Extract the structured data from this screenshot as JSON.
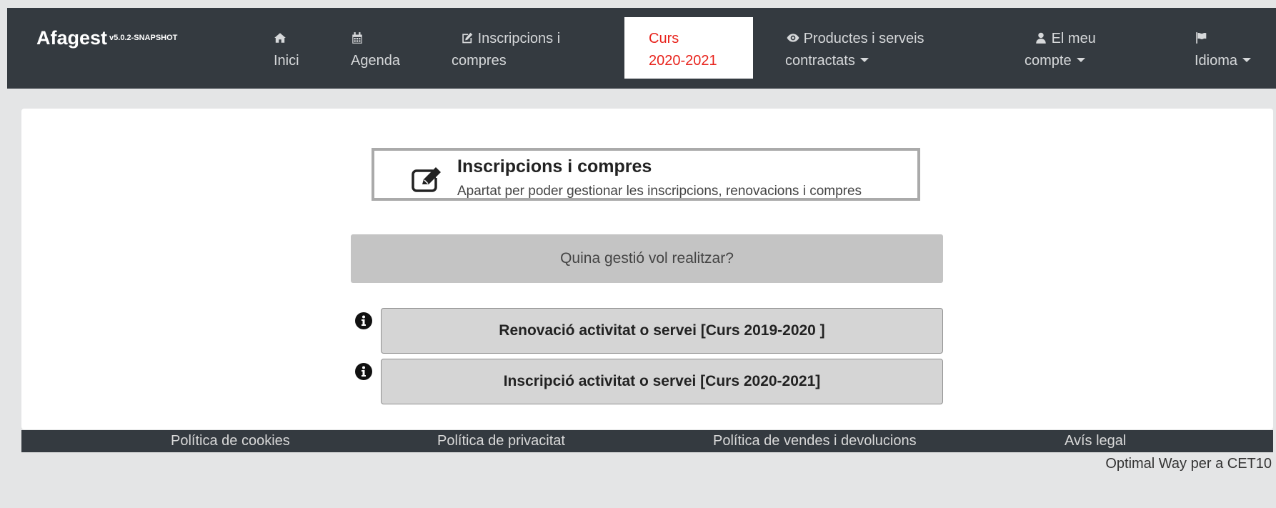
{
  "brand": {
    "name": "Afagest",
    "version": "v5.0.2-SNAPSHOT"
  },
  "nav": {
    "home": {
      "line1": "",
      "line2": "Inici",
      "icon": "home-icon"
    },
    "agenda": {
      "line1": "",
      "line2": "Agenda",
      "icon": "calendar-icon"
    },
    "enrollments": {
      "line1": "Inscripcions i",
      "line2": "compres",
      "icon": "edit-icon"
    },
    "course": {
      "line1": "Curs",
      "line2": "2020-2021"
    },
    "products": {
      "line1": "Productes i serveis",
      "line2": "contractats",
      "icon": "eye-icon"
    },
    "account": {
      "line1": "El meu",
      "line2": "compte",
      "icon": "user-icon"
    },
    "language": {
      "line1": "",
      "line2": "Idioma",
      "icon": "flag-icon"
    }
  },
  "section": {
    "title": "Inscripcions i compres",
    "subtitle": "Apartat per poder gestionar les inscripcions, renovacions i compres",
    "icon": "edit-icon"
  },
  "question": "Quina gestió vol realitzar?",
  "actions": [
    {
      "label": "Renovació activitat o servei [Curs 2019-2020 ]",
      "icon": "info-icon"
    },
    {
      "label": "Inscripció activitat o servei [Curs 2020-2021]",
      "icon": "info-icon"
    }
  ],
  "footer": {
    "cookies": "Política de cookies",
    "privacy": "Política de privacitat",
    "sales": "Política de vendes i devolucions",
    "legal": "Avís legal"
  },
  "credit": "Optimal Way per a CET10",
  "colors": {
    "navbar": "#343a40",
    "active_tab_text": "#e8231c",
    "question_bar": "#c4c4c4",
    "action_button": "#d5d5d5"
  }
}
